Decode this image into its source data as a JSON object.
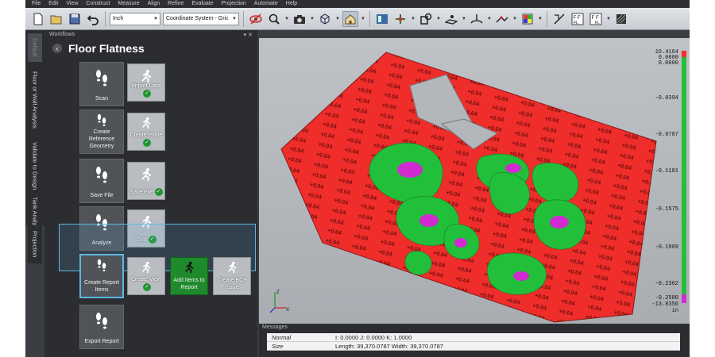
{
  "menu": [
    "File",
    "Edit",
    "View",
    "Construct",
    "Measure",
    "Align",
    "Refine",
    "Evaluate",
    "Projection",
    "Automate",
    "Help"
  ],
  "toolbar": {
    "units_value": "Inch",
    "coordinate_system_value": "Coordinate System - Gric"
  },
  "side_tabs": [
    "Default",
    "Floor or Wall Analysis",
    "Validate to Design",
    "Tank Analysis",
    "Projection"
  ],
  "workflows": {
    "panel_label": "Workflows",
    "title": "Floor Flatness",
    "steps": [
      {
        "label": "Scan",
        "substep": {
          "label": "Import Data",
          "done": true
        }
      },
      {
        "label": "Create Reference Geometry",
        "substep": {
          "label": "Create Plane",
          "done": true
        }
      },
      {
        "label": "Save File",
        "substep": {
          "label": "Save File",
          "done": true
        }
      },
      {
        "label": "Analyze",
        "substep": {
          "label": "Grid",
          "done": true
        }
      },
      {
        "label": "Create Report Items",
        "substeps": [
          {
            "label": "Create View",
            "done": true
          },
          {
            "label": "Add Items to Report",
            "active": true
          },
          {
            "label": "Create BCF Issue"
          }
        ]
      },
      {
        "label": "Export Report"
      }
    ]
  },
  "viewport": {
    "scale_labels": [
      "10.4164",
      "0.0000",
      "0.0000",
      "-0.0394",
      "-0.0787",
      "-0.1181",
      "-0.1575",
      "-0.1969",
      "-0.2362",
      "-0.2500",
      "-13.8356",
      "in"
    ],
    "colors": {
      "above": "#ff2a2a",
      "within": "#22c03a",
      "below": "#d12ad1",
      "background": "#b3b6ba"
    }
  },
  "messages": {
    "panel_label": "Messages",
    "rows": [
      {
        "key": "Normal",
        "value": "I: 0.0000 J: 0.0000 K: 1.0000"
      },
      {
        "key": "Size",
        "value": "Length: 39,370.0787 Width: 39,370.0787"
      }
    ]
  }
}
